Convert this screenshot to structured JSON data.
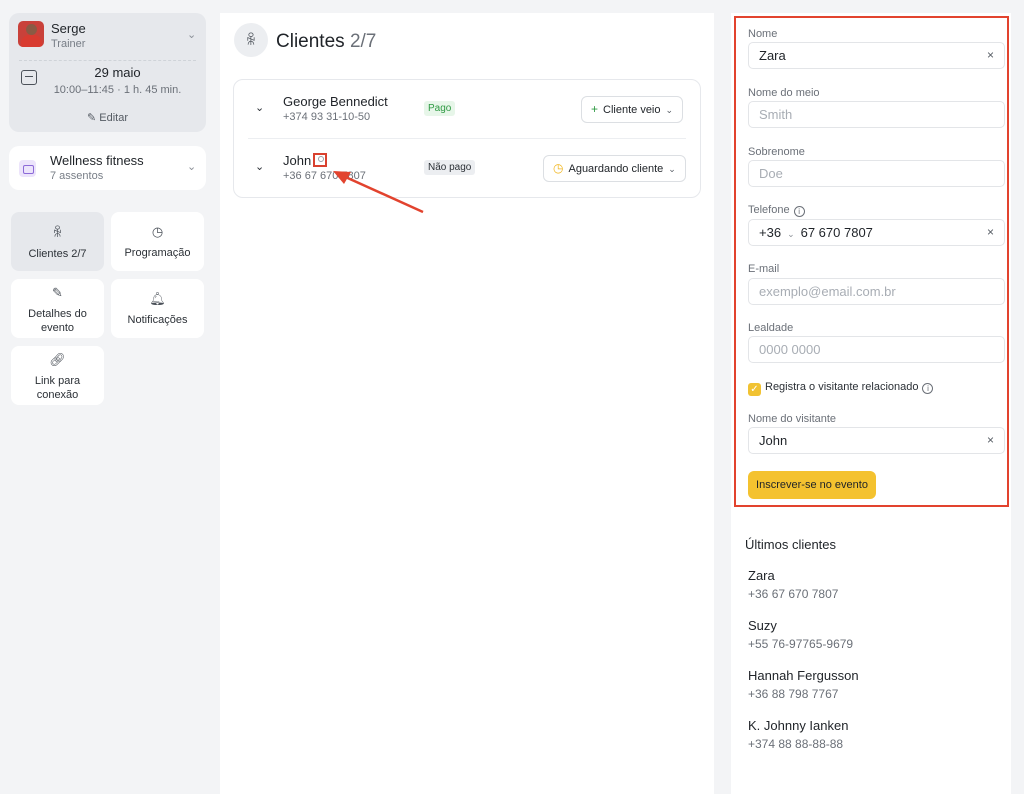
{
  "sidebar": {
    "trainer": {
      "name": "Serge",
      "role": "Trainer"
    },
    "event": {
      "date": "29 maio",
      "time": "10:00–11:45 · 1 h. 45 min.",
      "edit_label": "Editar"
    },
    "service": {
      "name": "Wellness fitness",
      "seats": "7 assentos"
    },
    "nav": {
      "clients": "Clientes 2/7",
      "schedule": "Programação",
      "event_details_1": "Detalhes do",
      "event_details_2": "evento",
      "notifications": "Notificações",
      "link_1": "Link para",
      "link_2": "conexão"
    }
  },
  "clients": {
    "title": "Clientes",
    "count": "2/7",
    "rows": [
      {
        "name": "George Bennedict",
        "phone": "+374 93 31-10-50",
        "payment": "Pago",
        "status": "Cliente veio"
      },
      {
        "name": "John",
        "phone": "+36 67 670 7807",
        "payment": "Não pago",
        "status": "Aguardando cliente"
      }
    ]
  },
  "form": {
    "first_name": {
      "label": "Nome",
      "value": "Zara"
    },
    "middle_name": {
      "label": "Nome do meio",
      "placeholder": "Smith"
    },
    "last_name": {
      "label": "Sobrenome",
      "placeholder": "Doe"
    },
    "phone": {
      "label": "Telefone",
      "country_code": "+36",
      "value": "67 670 7807"
    },
    "email": {
      "label": "E-mail",
      "placeholder": "exemplo@email.com.br"
    },
    "loyalty": {
      "label": "Lealdade",
      "placeholder": "0000 0000"
    },
    "related_visitor_checkbox": "Registra o visitante relacionado",
    "visitor_name": {
      "label": "Nome do visitante",
      "value": "John"
    },
    "submit_label": "Inscrever-se no evento"
  },
  "recent": {
    "title": "Últimos clientes",
    "items": [
      {
        "name": "Zara",
        "phone": "+36 67 670 7807"
      },
      {
        "name": "Suzy",
        "phone": "+55 76-97765-9679"
      },
      {
        "name": "Hannah Fergusson",
        "phone": "+36 88 798 7767"
      },
      {
        "name": "K. Johnny Ianken",
        "phone": "+374 88 88-88-88"
      }
    ]
  },
  "colors": {
    "accent": "#f4c22f",
    "highlight": "#e2432e",
    "paid": "#2f9a43"
  },
  "icons": [
    "chevron-down-icon",
    "calendar-icon",
    "pencil-icon",
    "users-icon",
    "clock-icon",
    "edit-doc-icon",
    "bell-icon",
    "link-icon",
    "plus-icon",
    "clock-outline-icon",
    "person-icon",
    "close-icon",
    "info-icon",
    "check-icon"
  ]
}
